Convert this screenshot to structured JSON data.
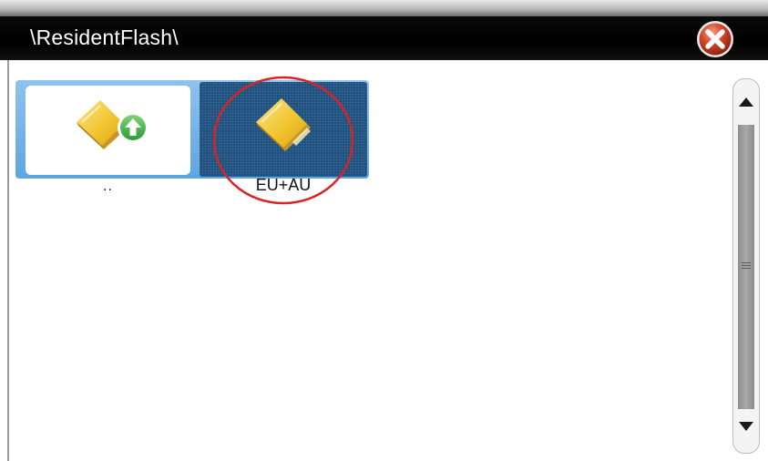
{
  "window": {
    "title": "\\ResidentFlash\\",
    "close_icon": "close-icon"
  },
  "items": [
    {
      "label": "..",
      "icon": "folder-up-icon",
      "selected": false
    },
    {
      "label": "EU+AU",
      "icon": "folder-icon",
      "selected": true
    }
  ],
  "colors": {
    "titlebar": "#000000",
    "tile_strip": "#6aaee6",
    "selected_tile": "#1d4f7e",
    "folder": "#f2c531",
    "up_arrow": "#3fae3f",
    "close_button": "#c8371c",
    "highlight_ring": "#d82424"
  }
}
